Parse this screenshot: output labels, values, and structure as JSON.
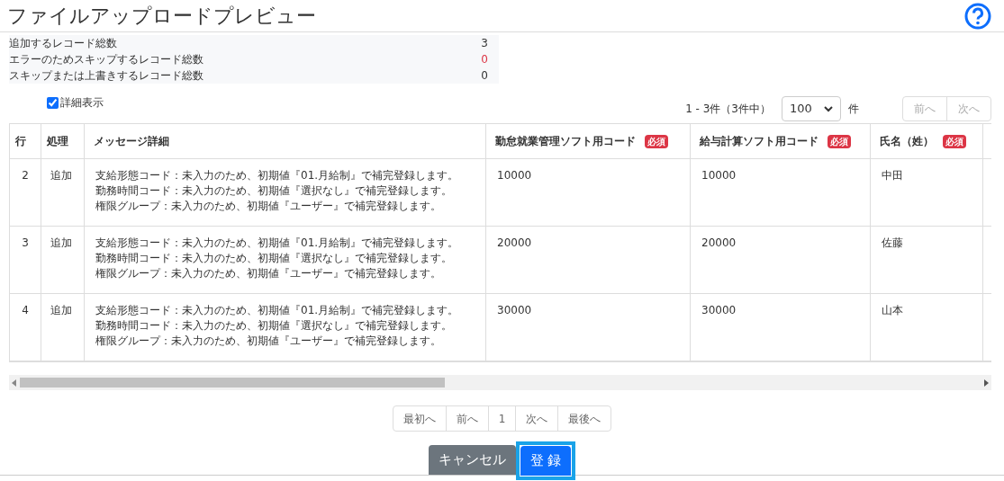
{
  "title": "ファイルアップロードプレビュー",
  "summary": [
    {
      "label": "追加するレコード総数",
      "value": "3",
      "kind": "normal"
    },
    {
      "label": "エラーのためスキップするレコード総数",
      "value": "0",
      "kind": "error"
    },
    {
      "label": "スキップまたは上書きするレコード総数",
      "value": "0",
      "kind": "normal"
    }
  ],
  "detail_toggle": {
    "label": "詳細表示",
    "checked": true
  },
  "range": "1 - 3件（3件中）",
  "page_size": "100",
  "page_size_unit": "件",
  "pager_top": [
    {
      "label": "前へ",
      "disabled": true
    },
    {
      "label": "次へ",
      "disabled": true
    }
  ],
  "table": {
    "columns": [
      {
        "label": "行"
      },
      {
        "label": "処理"
      },
      {
        "label": "メッセージ詳細"
      },
      {
        "label": "勤怠就業管理ソフト用コード",
        "badge": "必須"
      },
      {
        "label": "給与計算ソフト用コード",
        "badge": "必須"
      },
      {
        "label": "氏名（姓）",
        "badge": "必須"
      }
    ],
    "rows": [
      {
        "cells": [
          "2",
          "追加",
          [
            "支給形態コード：未入力のため、初期値『01.月給制』で補完登録します。",
            "勤務時間コード：未入力のため、初期値『選択なし』で補完登録します。",
            "権限グループ：未入力のため、初期値『ユーザー』で補完登録します。"
          ],
          "10000",
          "10000",
          "中田"
        ]
      },
      {
        "cells": [
          "3",
          "追加",
          [
            "支給形態コード：未入力のため、初期値『01.月給制』で補完登録します。",
            "勤務時間コード：未入力のため、初期値『選択なし』で補完登録します。",
            "権限グループ：未入力のため、初期値『ユーザー』で補完登録します。"
          ],
          "20000",
          "20000",
          "佐藤"
        ]
      },
      {
        "cells": [
          "4",
          "追加",
          [
            "支給形態コード：未入力のため、初期値『01.月給制』で補完登録します。",
            "勤務時間コード：未入力のため、初期値『選択なし』で補完登録します。",
            "権限グループ：未入力のため、初期値『ユーザー』で補完登録します。"
          ],
          "30000",
          "30000",
          "山本"
        ]
      }
    ]
  },
  "pagination": [
    "最初へ",
    "前へ",
    "1",
    "次へ",
    "最後へ"
  ],
  "buttons": [
    {
      "label": "キャンセル",
      "kind": "secondary",
      "focused": false
    },
    {
      "label": "登 録",
      "kind": "primary",
      "focused": true
    }
  ]
}
